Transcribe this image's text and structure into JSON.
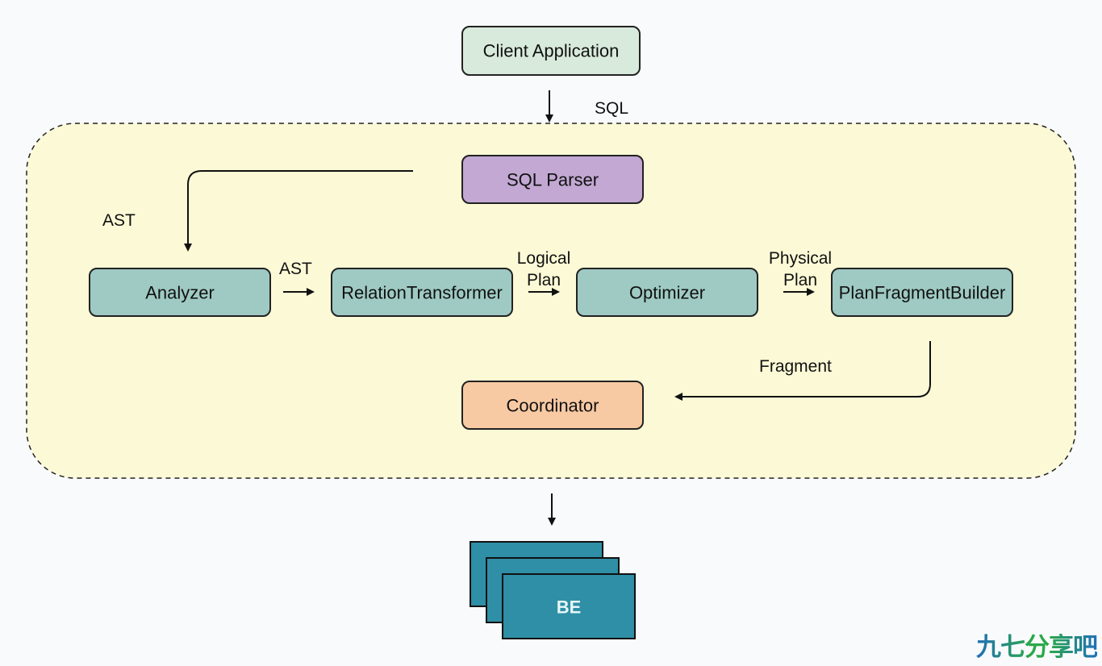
{
  "nodes": {
    "client": "Client Application",
    "parser": "SQL Parser",
    "analyzer": "Analyzer",
    "relation_transformer": "RelationTransformer",
    "optimizer": "Optimizer",
    "plan_fragment_builder": "PlanFragmentBuilder",
    "coordinator": "Coordinator",
    "be": "BE"
  },
  "edges": {
    "sql": "SQL",
    "ast_parser": "AST",
    "ast_analyzer": "AST",
    "logical_1": "Logical",
    "logical_2": "Plan",
    "physical_1": "Physical",
    "physical_2": "Plan",
    "fragment": "Fragment"
  },
  "colors": {
    "client": "#d8eadb",
    "parser": "#c2a8d2",
    "stage": "#9ecac3",
    "coordinator": "#f8caa3",
    "be": "#2e8fa6",
    "container": "#fcf9d6"
  },
  "watermark": "九七分享吧"
}
